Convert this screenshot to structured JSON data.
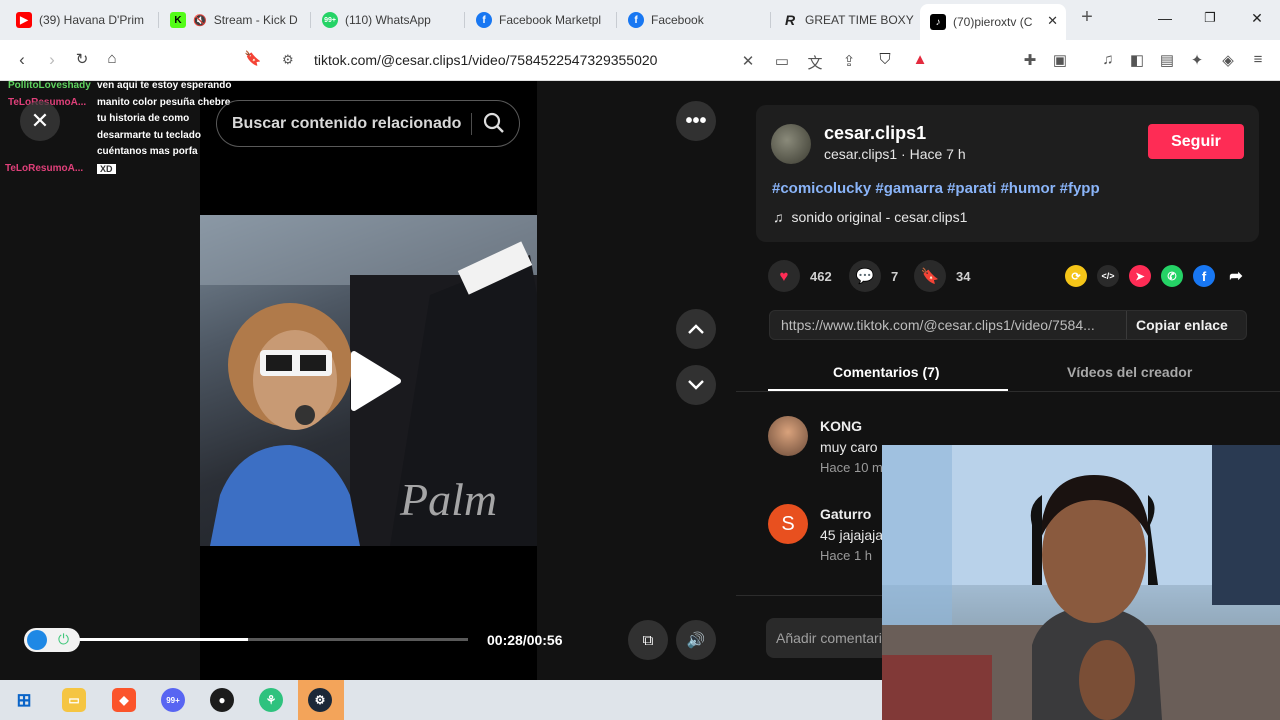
{
  "browser": {
    "tabs": [
      {
        "title": "(39) Havana D'Prim",
        "icon": "youtube-icon",
        "color": "#ff0000"
      },
      {
        "title": "Stream - Kick D",
        "icon": "kick-icon",
        "color": "#53fc18"
      },
      {
        "title": "(110) WhatsApp",
        "icon": "whatsapp-icon",
        "color": "#25d366"
      },
      {
        "title": "Facebook Marketpl",
        "icon": "facebook-icon",
        "color": "#1877f2"
      },
      {
        "title": "Facebook",
        "icon": "facebook-icon",
        "color": "#1877f2"
      },
      {
        "title": "GREAT TIME BOXY",
        "icon": "r-icon",
        "color": "#222222"
      },
      {
        "title": "(70)pieroxtv (C",
        "icon": "tiktok-icon",
        "color": "#000000",
        "active": true
      }
    ],
    "url": "tiktok.com/@cesar.clips1/video/7584522547329355020"
  },
  "chat": [
    {
      "user": "PollitoLoveshady",
      "user_color": "#5fd35f",
      "message": "ven aqui te estoy esperando"
    },
    {
      "user": "TeLoResumoA...",
      "user_color": "#e0407a",
      "message": "manito color pesuña chebre"
    },
    {
      "user": "",
      "user_color": "#e0407a",
      "message": "tu historia de como"
    },
    {
      "user": "",
      "user_color": "#e0407a",
      "message": "desarmarte tu teclado"
    },
    {
      "user": "",
      "user_color": "#e0407a",
      "message": "cuéntanos mas porfa"
    },
    {
      "user": "TeLoResumoA...",
      "user_color": "#e0407a",
      "message": "XD"
    }
  ],
  "video": {
    "search_placeholder": "Buscar contenido relacionado",
    "time": "00:28/00:56",
    "progress": 0.5
  },
  "creator": {
    "username": "cesar.clips1",
    "subline": "cesar.clips1 · Hace 7 h",
    "follow_label": "Seguir",
    "hashtags": "#comicolucky #gamarra #parati #humor #fypp",
    "sound": "sonido original - cesar.clips1"
  },
  "stats": {
    "likes": "462",
    "comments": "7",
    "saves": "34"
  },
  "link": {
    "url": "https://www.tiktok.com/@cesar.clips1/video/7584...",
    "copy_label": "Copiar enlace"
  },
  "panel_tabs": {
    "comments": "Comentarios (7)",
    "creator_videos": "Vídeos del creador"
  },
  "comments": [
    {
      "name": "KONG",
      "text": "muy caro",
      "time": "Hace 10 m",
      "avatar_letter": ""
    },
    {
      "name": "Gaturro",
      "text": "45 jajajaja",
      "time": "Hace 1 h",
      "avatar_letter": "S"
    }
  ],
  "add_comment_placeholder": "Añadir comentario...",
  "colors": {
    "accent": "#fe2c55",
    "hashtag": "#8ab4f8",
    "panel_bg": "#121212"
  }
}
